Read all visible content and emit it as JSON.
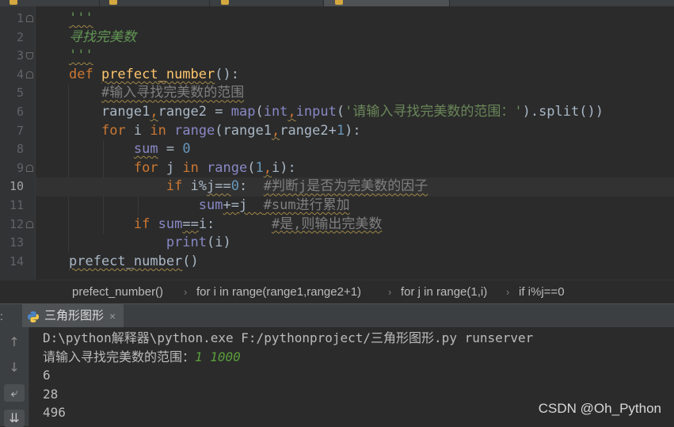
{
  "editor": {
    "line_numbers": [
      "1",
      "2",
      "3",
      "4",
      "5",
      "6",
      "7",
      "8",
      "9",
      "10",
      "11",
      "12",
      "13",
      "14"
    ],
    "current_line": 10,
    "lines": [
      [
        {
          "t": "'''",
          "c": "doc sq"
        }
      ],
      [
        {
          "t": "寻找完美数",
          "c": "doc"
        }
      ],
      [
        {
          "t": "'''",
          "c": "doc sq"
        }
      ],
      [
        {
          "t": "def ",
          "c": "kw"
        },
        {
          "t": "prefect_number",
          "c": "fn sq"
        },
        {
          "t": "():",
          "c": ""
        }
      ],
      [
        {
          "t": "    ",
          "c": ""
        },
        {
          "t": "#输入寻找完美数的范围",
          "c": "cm sq"
        }
      ],
      [
        {
          "t": "    range1",
          "c": ""
        },
        {
          "t": ",",
          "c": "kw sq"
        },
        {
          "t": "range2 = ",
          "c": ""
        },
        {
          "t": "map",
          "c": "bi"
        },
        {
          "t": "(",
          "c": ""
        },
        {
          "t": "int",
          "c": "bi"
        },
        {
          "t": ",",
          "c": "kw sq"
        },
        {
          "t": "input",
          "c": "bi"
        },
        {
          "t": "(",
          "c": ""
        },
        {
          "t": "'请输入寻找完美数的范围：'",
          "c": "str"
        },
        {
          "t": ").split())",
          "c": ""
        }
      ],
      [
        {
          "t": "    ",
          "c": ""
        },
        {
          "t": "for ",
          "c": "kw"
        },
        {
          "t": "i ",
          "c": ""
        },
        {
          "t": "in ",
          "c": "kw"
        },
        {
          "t": "range",
          "c": "bi"
        },
        {
          "t": "(range1",
          "c": ""
        },
        {
          "t": ",",
          "c": "kw sq"
        },
        {
          "t": "range2+",
          "c": ""
        },
        {
          "t": "1",
          "c": "num"
        },
        {
          "t": "):",
          "c": ""
        }
      ],
      [
        {
          "t": "        ",
          "c": ""
        },
        {
          "t": "sum",
          "c": "bi sq"
        },
        {
          "t": " = ",
          "c": ""
        },
        {
          "t": "0",
          "c": "num"
        }
      ],
      [
        {
          "t": "        ",
          "c": ""
        },
        {
          "t": "for ",
          "c": "kw"
        },
        {
          "t": "j ",
          "c": ""
        },
        {
          "t": "in ",
          "c": "kw"
        },
        {
          "t": "range",
          "c": "bi"
        },
        {
          "t": "(",
          "c": ""
        },
        {
          "t": "1",
          "c": "num"
        },
        {
          "t": ",",
          "c": "kw sq"
        },
        {
          "t": "i):",
          "c": ""
        }
      ],
      [
        {
          "t": "            ",
          "c": ""
        },
        {
          "t": "if ",
          "c": "kw"
        },
        {
          "t": "i%",
          "c": ""
        },
        {
          "t": "j==",
          "c": "sq"
        },
        {
          "t": "0",
          "c": "num"
        },
        {
          "t": ":  ",
          "c": ""
        },
        {
          "t": "#判断j是否为完美数的因子",
          "c": "cm sq"
        }
      ],
      [
        {
          "t": "                ",
          "c": ""
        },
        {
          "t": "sum",
          "c": "bi"
        },
        {
          "t": "+=j  ",
          "c": "sq"
        },
        {
          "t": "#sum进行累加",
          "c": "cm sq"
        }
      ],
      [
        {
          "t": "        ",
          "c": ""
        },
        {
          "t": "if ",
          "c": "kw"
        },
        {
          "t": "sum",
          "c": "bi"
        },
        {
          "t": "==",
          "c": "sq"
        },
        {
          "t": "i:       ",
          "c": ""
        },
        {
          "t": "#是,则输出完美数",
          "c": "cm sq"
        }
      ],
      [
        {
          "t": "            ",
          "c": ""
        },
        {
          "t": "print",
          "c": "bi"
        },
        {
          "t": "(i)",
          "c": ""
        }
      ],
      [
        {
          "t": "prefect_number",
          "c": "sq"
        },
        {
          "t": "()",
          "c": ""
        }
      ]
    ]
  },
  "breadcrumb": [
    "prefect_number()",
    "for i in range(range1,range2+1)",
    "for j in range(1,i)",
    "if i%j==0"
  ],
  "run_panel": {
    "left_label": ":",
    "tab_title": "三角形图形",
    "close_glyph": "×"
  },
  "console": {
    "lines": [
      {
        "text": "D:\\python解释器\\python.exe F:/pythonproject/三角形图形.py runserver"
      },
      {
        "text": "请输入寻找完美数的范围：",
        "input": "1 1000"
      },
      {
        "text": "6"
      },
      {
        "text": "28"
      },
      {
        "text": "496"
      }
    ],
    "side_buttons": [
      "↑",
      "↓",
      "⤶",
      "⇊"
    ]
  },
  "watermark": "CSDN @Oh_Python",
  "colors": {
    "keyword": "#cc7832",
    "function": "#ffc66d",
    "builtin": "#8888c6",
    "number": "#6897bb",
    "string": "#6a8759",
    "comment": "#808080",
    "docstring": "#629755"
  }
}
